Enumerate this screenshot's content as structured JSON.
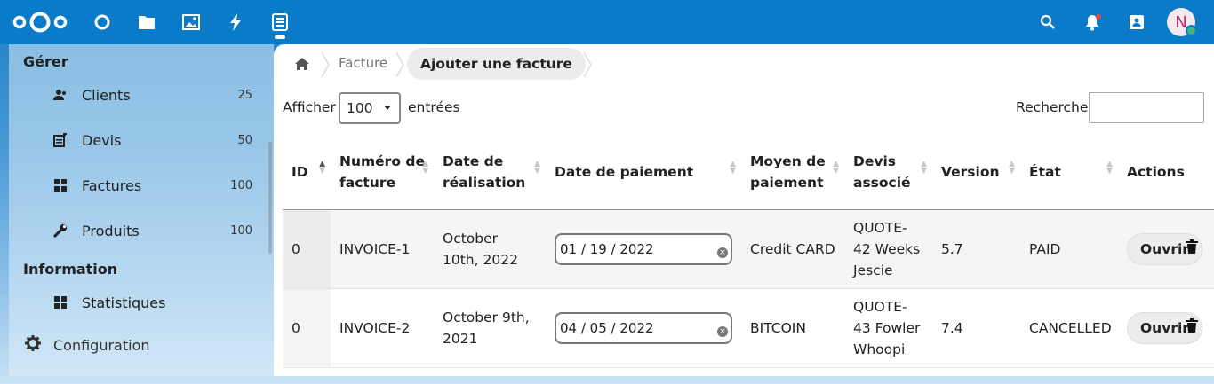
{
  "header": {
    "apps": [
      "logo-icon",
      "dashboard-icon",
      "files-icon",
      "photos-icon",
      "activity-icon",
      "invoices-app-icon"
    ],
    "right_icons": [
      "search-icon",
      "notifications-icon",
      "contacts-icon"
    ],
    "avatar_initial": "N",
    "accent": "#0a7bc9"
  },
  "sidebar": {
    "manage_heading": "Gérer",
    "items": [
      {
        "label": "Clients",
        "count": "25",
        "icon": "clients-icon"
      },
      {
        "label": "Devis",
        "count": "50",
        "icon": "quotes-icon"
      },
      {
        "label": "Factures",
        "count": "100",
        "icon": "invoices-icon"
      },
      {
        "label": "Produits",
        "count": "100",
        "icon": "products-icon"
      }
    ],
    "info_heading": "Information",
    "stats_label": "Statistiques",
    "config_label": "Configuration"
  },
  "breadcrumb": {
    "home_icon": "home-icon",
    "parent": "Facture",
    "current": "Ajouter une facture"
  },
  "table_controls": {
    "show_label": "Afficher",
    "page_size": "100",
    "entries_label": "entrées",
    "search_label": "Recherche"
  },
  "table": {
    "headers": {
      "id": "ID",
      "number": "Numéro de facture",
      "done_date": "Date de réalisation",
      "pay_date": "Date de paiement",
      "pay_method": "Moyen de paiement",
      "quote": "Devis associé",
      "version": "Version",
      "state": "État",
      "actions": "Actions"
    },
    "rows": [
      {
        "id": "0",
        "number": "INVOICE-1",
        "done_date": "October 10th, 2022",
        "pay_date": "01 / 19 / 2022",
        "pay_method": "Credit CARD",
        "quote": "QUOTE-42 Weeks Jescie",
        "version": "5.7",
        "state": "PAID",
        "open": "Ouvrir"
      },
      {
        "id": "0",
        "number": "INVOICE-2",
        "done_date": "October 9th, 2021",
        "pay_date": "04 / 05 / 2022",
        "pay_method": "BITCOIN",
        "quote": "QUOTE-43 Fowler Whoopi",
        "version": "7.4",
        "state": "CANCELLED",
        "open": "Ouvrir"
      }
    ]
  }
}
